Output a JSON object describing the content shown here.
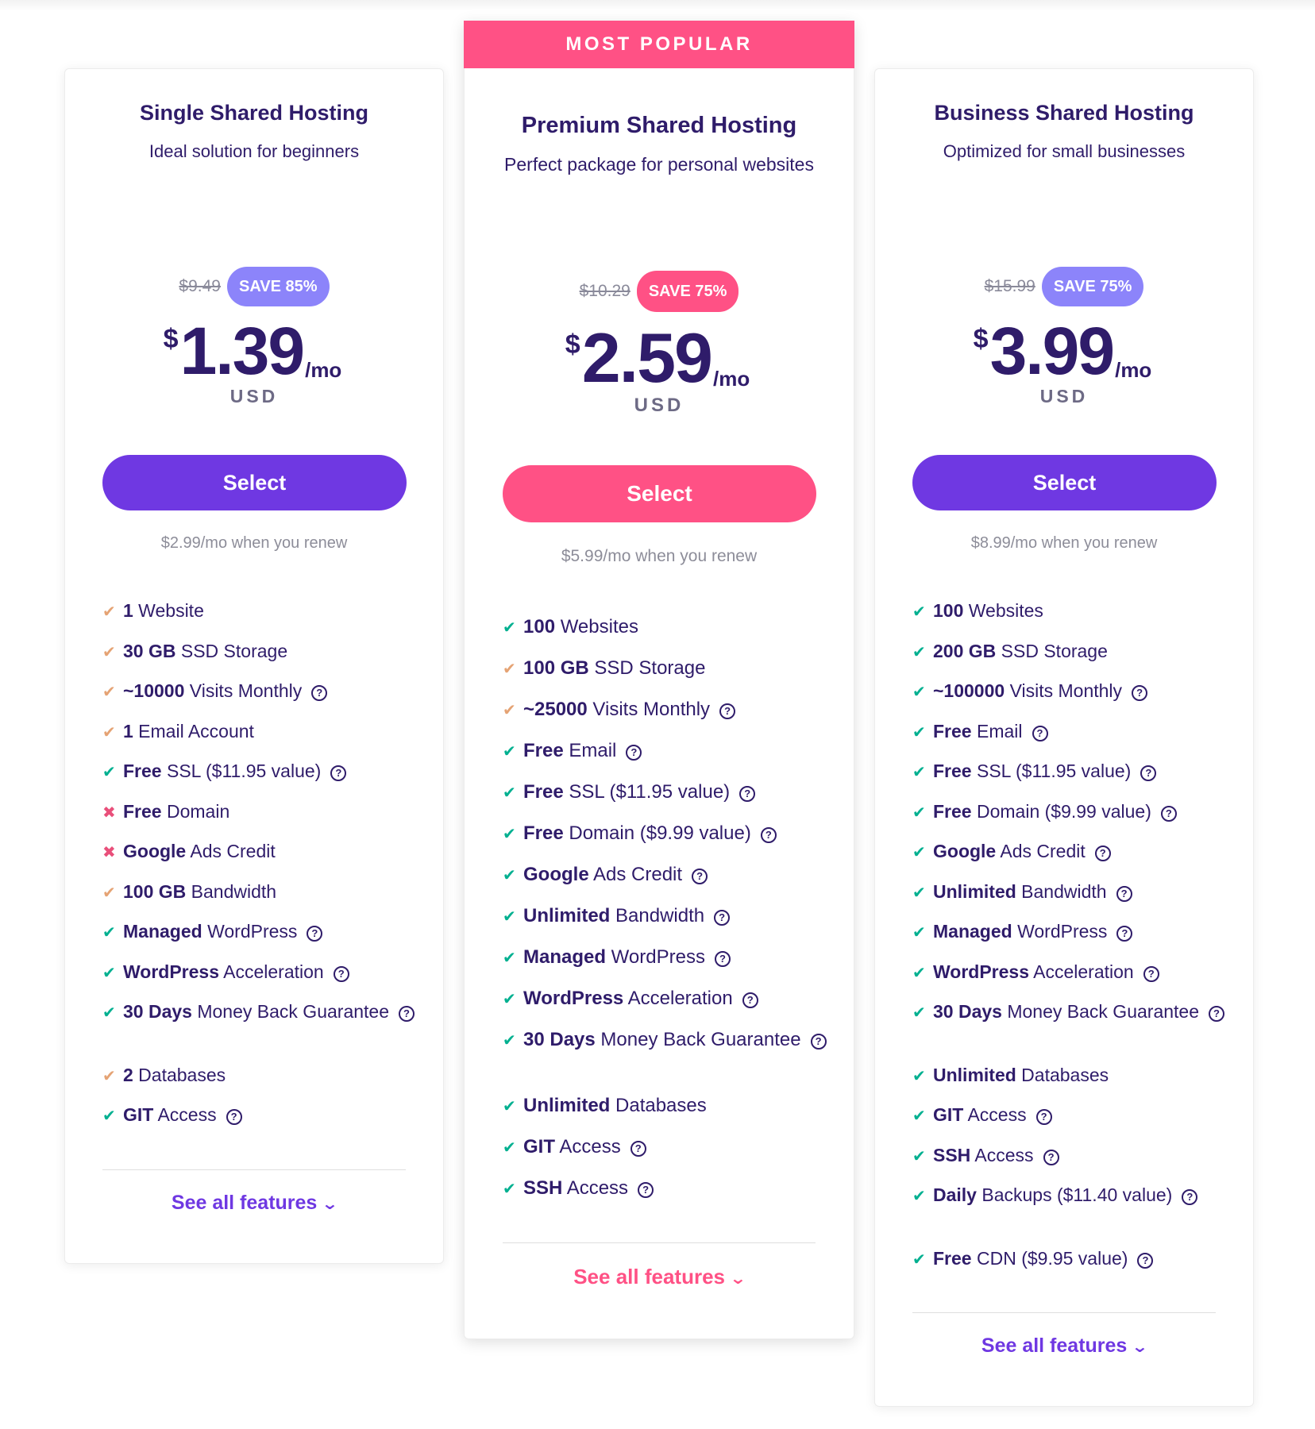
{
  "colors": {
    "purple": "#6f38e2",
    "pink": "#ff5185",
    "badge_purple": "#8c84fa",
    "navy": "#2f1c6a",
    "check_green": "#00b090",
    "check_orange": "#e5a374",
    "cross_red": "#e94f7a"
  },
  "plans": [
    {
      "title": "Single Shared Hosting",
      "subtitle": "Ideal solution for beginners",
      "old_price": "$9.49",
      "save_badge": "SAVE 85%",
      "currency_symbol": "$",
      "price": "1.39",
      "period": "/mo",
      "currency": "USD",
      "select_label": "Select",
      "renew_text": "$2.99/mo when you renew",
      "see_all_label": "See all features",
      "features": [
        {
          "status": "partial",
          "icon": "check-icon",
          "bold": "1",
          "text": " Website",
          "help": false
        },
        {
          "status": "partial",
          "icon": "check-icon",
          "bold": "30 GB",
          "text": " SSD Storage",
          "help": false
        },
        {
          "status": "partial",
          "icon": "check-icon",
          "bold": "~10000",
          "text": " Visits Monthly",
          "help": true
        },
        {
          "status": "partial",
          "icon": "check-icon",
          "bold": "1",
          "text": " Email Account",
          "help": false
        },
        {
          "status": "included",
          "icon": "check-icon",
          "bold": "Free",
          "text": " SSL ($11.95 value)",
          "help": true
        },
        {
          "status": "excluded",
          "icon": "cross-icon",
          "bold": "Free",
          "text": " Domain",
          "help": false
        },
        {
          "status": "excluded",
          "icon": "cross-icon",
          "bold": "Google",
          "text": " Ads Credit",
          "help": false
        },
        {
          "status": "partial",
          "icon": "check-icon",
          "bold": "100 GB",
          "text": " Bandwidth",
          "help": false
        },
        {
          "status": "included",
          "icon": "check-icon",
          "bold": "Managed",
          "text": " WordPress",
          "help": true
        },
        {
          "status": "included",
          "icon": "check-icon",
          "bold": "WordPress",
          "text": " Acceleration",
          "help": true
        },
        {
          "status": "included",
          "icon": "check-icon",
          "bold": "30 Days",
          "text": " Money Back Guarantee",
          "help": true
        },
        {
          "status": "partial",
          "icon": "check-icon",
          "bold": "2",
          "text": " Databases",
          "help": false
        },
        {
          "status": "included",
          "icon": "check-icon",
          "bold": "GIT",
          "text": " Access",
          "help": true
        }
      ]
    },
    {
      "banner": "MOST POPULAR",
      "title": "Premium Shared Hosting",
      "subtitle": "Perfect package for personal websites",
      "old_price": "$10.29",
      "save_badge": "SAVE 75%",
      "currency_symbol": "$",
      "price": "2.59",
      "period": "/mo",
      "currency": "USD",
      "select_label": "Select",
      "renew_text": "$5.99/mo when you renew",
      "see_all_label": "See all features",
      "features": [
        {
          "status": "included",
          "icon": "check-icon",
          "bold": "100",
          "text": " Websites",
          "help": false
        },
        {
          "status": "partial",
          "icon": "check-icon",
          "bold": "100 GB",
          "text": " SSD Storage",
          "help": false
        },
        {
          "status": "partial",
          "icon": "check-icon",
          "bold": "~25000",
          "text": " Visits Monthly",
          "help": true
        },
        {
          "status": "included",
          "icon": "check-icon",
          "bold": "Free",
          "text": " Email",
          "help": true
        },
        {
          "status": "included",
          "icon": "check-icon",
          "bold": "Free",
          "text": " SSL ($11.95 value)",
          "help": true
        },
        {
          "status": "included",
          "icon": "check-icon",
          "bold": "Free",
          "text": " Domain ($9.99 value)",
          "help": true
        },
        {
          "status": "included",
          "icon": "check-icon",
          "bold": "Google",
          "text": " Ads Credit",
          "help": true
        },
        {
          "status": "included",
          "icon": "check-icon",
          "bold": "Unlimited",
          "text": " Bandwidth",
          "help": true
        },
        {
          "status": "included",
          "icon": "check-icon",
          "bold": "Managed",
          "text": " WordPress",
          "help": true
        },
        {
          "status": "included",
          "icon": "check-icon",
          "bold": "WordPress",
          "text": " Acceleration",
          "help": true
        },
        {
          "status": "included",
          "icon": "check-icon",
          "bold": "30 Days",
          "text": " Money Back Guarantee",
          "help": true
        },
        {
          "status": "included",
          "icon": "check-icon",
          "bold": "Unlimited",
          "text": " Databases",
          "help": false
        },
        {
          "status": "included",
          "icon": "check-icon",
          "bold": "GIT",
          "text": " Access",
          "help": true
        },
        {
          "status": "included",
          "icon": "check-icon",
          "bold": "SSH",
          "text": " Access",
          "help": true
        }
      ]
    },
    {
      "title": "Business Shared Hosting",
      "subtitle": "Optimized for small businesses",
      "old_price": "$15.99",
      "save_badge": "SAVE 75%",
      "currency_symbol": "$",
      "price": "3.99",
      "period": "/mo",
      "currency": "USD",
      "select_label": "Select",
      "renew_text": "$8.99/mo when you renew",
      "see_all_label": "See all features",
      "features": [
        {
          "status": "included",
          "icon": "check-icon",
          "bold": "100",
          "text": " Websites",
          "help": false
        },
        {
          "status": "included",
          "icon": "check-icon",
          "bold": "200 GB",
          "text": " SSD Storage",
          "help": false
        },
        {
          "status": "included",
          "icon": "check-icon",
          "bold": "~100000",
          "text": " Visits Monthly",
          "help": true
        },
        {
          "status": "included",
          "icon": "check-icon",
          "bold": "Free",
          "text": " Email",
          "help": true
        },
        {
          "status": "included",
          "icon": "check-icon",
          "bold": "Free",
          "text": " SSL ($11.95 value)",
          "help": true
        },
        {
          "status": "included",
          "icon": "check-icon",
          "bold": "Free",
          "text": " Domain ($9.99 value)",
          "help": true
        },
        {
          "status": "included",
          "icon": "check-icon",
          "bold": "Google",
          "text": " Ads Credit",
          "help": true
        },
        {
          "status": "included",
          "icon": "check-icon",
          "bold": "Unlimited",
          "text": " Bandwidth",
          "help": true
        },
        {
          "status": "included",
          "icon": "check-icon",
          "bold": "Managed",
          "text": " WordPress",
          "help": true
        },
        {
          "status": "included",
          "icon": "check-icon",
          "bold": "WordPress",
          "text": " Acceleration",
          "help": true
        },
        {
          "status": "included",
          "icon": "check-icon",
          "bold": "30 Days",
          "text": " Money Back Guarantee",
          "help": true
        },
        {
          "status": "included",
          "icon": "check-icon",
          "bold": "Unlimited",
          "text": " Databases",
          "help": false
        },
        {
          "status": "included",
          "icon": "check-icon",
          "bold": "GIT",
          "text": " Access",
          "help": true
        },
        {
          "status": "included",
          "icon": "check-icon",
          "bold": "SSH",
          "text": " Access",
          "help": true
        },
        {
          "status": "included",
          "icon": "check-icon",
          "bold": "Daily",
          "text": " Backups ($11.40 value)",
          "help": true
        },
        {
          "status": "included",
          "icon": "check-icon",
          "bold": "Free",
          "text": " CDN ($9.95 value)",
          "help": true
        }
      ]
    }
  ]
}
